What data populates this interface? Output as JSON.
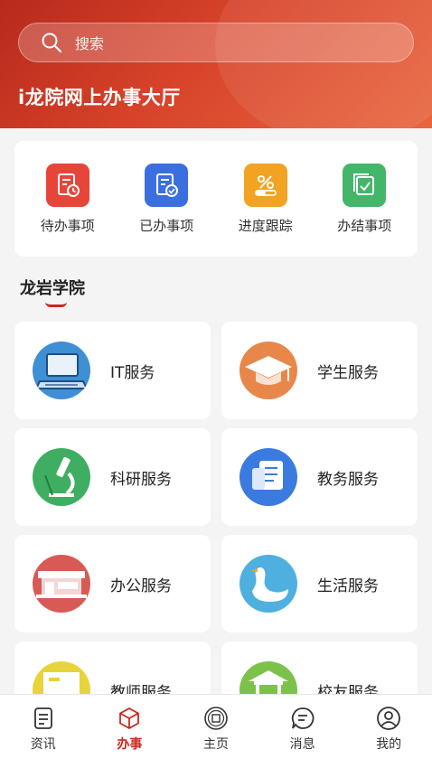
{
  "header": {
    "search_placeholder": "搜索",
    "title": "i龙院网上办事大厅"
  },
  "quick_actions": [
    {
      "label": "待办事项",
      "icon": "todo-clock-icon",
      "color": "#e8453a"
    },
    {
      "label": "已办事项",
      "icon": "done-check-icon",
      "color": "#3b6fe0"
    },
    {
      "label": "进度跟踪",
      "icon": "progress-percent-icon",
      "color": "#f3a322"
    },
    {
      "label": "办结事项",
      "icon": "completed-check-icon",
      "color": "#44b66a"
    }
  ],
  "section": {
    "title": "龙岩学院",
    "accent": "#c8281b"
  },
  "services": [
    {
      "label": "IT服务",
      "icon": "laptop-icon",
      "color": "#3f8fd4"
    },
    {
      "label": "学生服务",
      "icon": "graduation-cap-icon",
      "color": "#e8874a"
    },
    {
      "label": "科研服务",
      "icon": "microscope-icon",
      "color": "#3fae62"
    },
    {
      "label": "教务服务",
      "icon": "document-stack-icon",
      "color": "#3b7be0"
    },
    {
      "label": "办公服务",
      "icon": "office-building-icon",
      "color": "#d85a55"
    },
    {
      "label": "生活服务",
      "icon": "swan-icon",
      "color": "#4fb0e0"
    },
    {
      "label": "教师服务",
      "icon": "teacher-board-icon",
      "color": "#e6d43a"
    },
    {
      "label": "校友服务",
      "icon": "pavilion-icon",
      "color": "#7cc24a"
    }
  ],
  "tabbar": [
    {
      "label": "资讯",
      "icon": "news-doc-icon",
      "active": false
    },
    {
      "label": "办事",
      "icon": "cube-icon",
      "active": true
    },
    {
      "label": "主页",
      "icon": "home-emblem-icon",
      "active": false
    },
    {
      "label": "消息",
      "icon": "message-bubble-icon",
      "active": false
    },
    {
      "label": "我的",
      "icon": "user-profile-icon",
      "active": false
    }
  ]
}
